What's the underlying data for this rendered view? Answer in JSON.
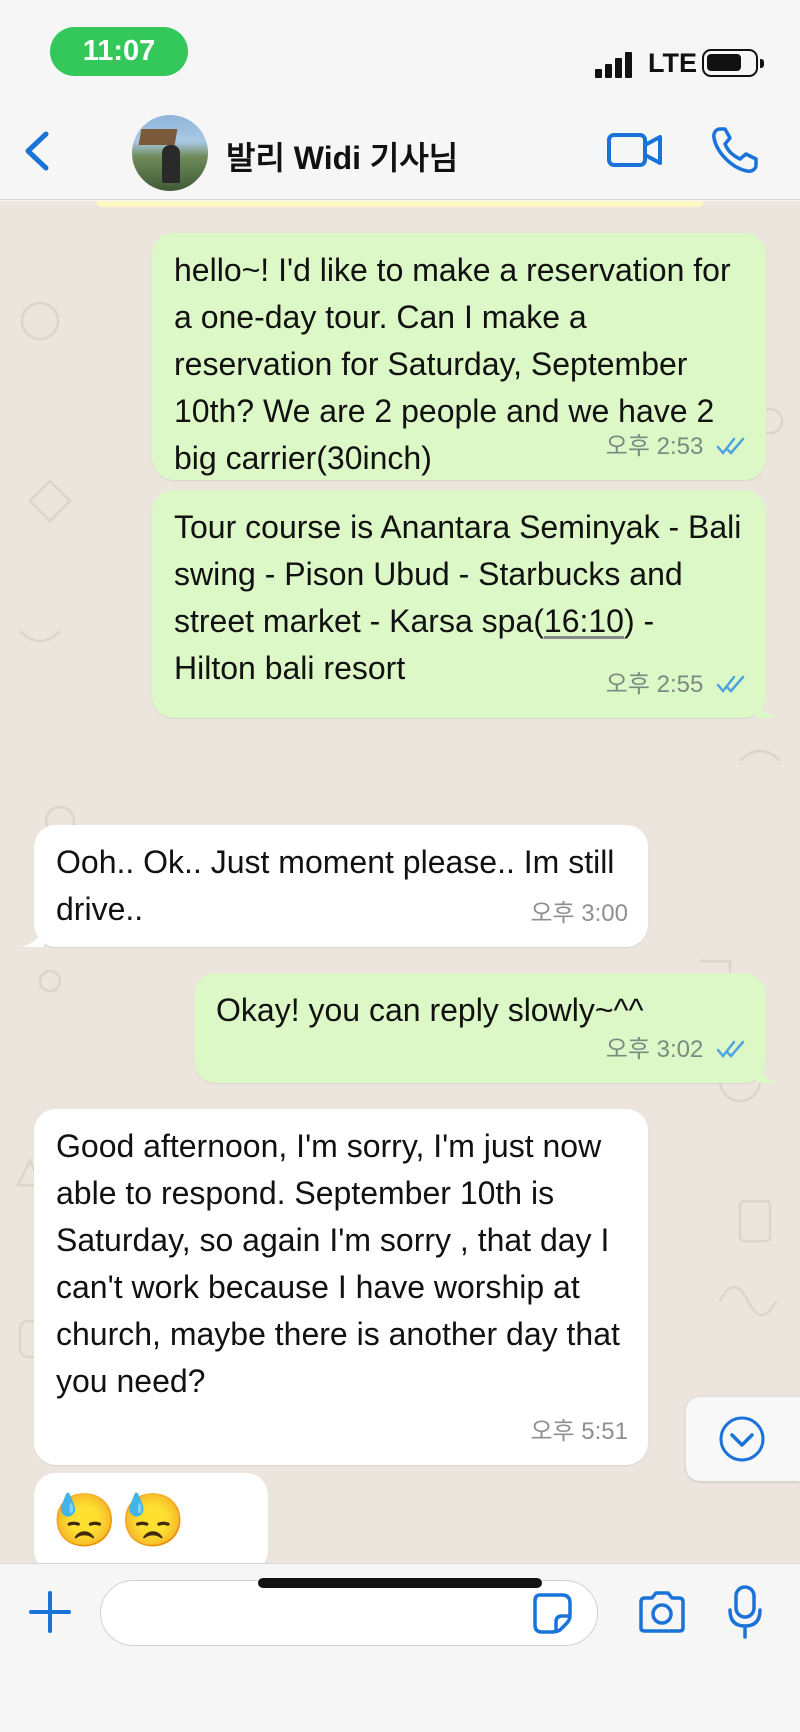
{
  "status_bar": {
    "time": "11:07",
    "network": "LTE"
  },
  "header": {
    "contact_name": "발리 Widi 기사님",
    "icons": {
      "back": "chevron-left-icon",
      "video": "video-camera-icon",
      "call": "phone-icon"
    }
  },
  "messages": [
    {
      "direction": "outgoing",
      "text": "hello~! I'd like to make a reservation for a one-day tour. Can I make a reservation for Saturday, September 10th? We are 2 people and we have 2 big carrier(30inch)",
      "time": "오후 2:53",
      "status": "read"
    },
    {
      "direction": "outgoing",
      "text_before": "Tour course is Anantara Seminyak - Bali swing - Pison Ubud - Starbucks and street market - Karsa spa(",
      "text_link": "16:10",
      "text_after": ") - Hilton bali resort",
      "time": "오후 2:55",
      "status": "read"
    },
    {
      "direction": "incoming",
      "text": "Ooh.. Ok.. Just moment please.. Im still drive..",
      "time": "오후 3:00"
    },
    {
      "direction": "outgoing",
      "text": "Okay! you can reply slowly~^^",
      "time": "오후 3:02",
      "status": "read"
    },
    {
      "direction": "incoming",
      "text": "Good afternoon, I'm sorry, I'm just now able to respond. September 10th is Saturday, so again I'm sorry , that day I can't work because I have worship at church, maybe there is another day that you need?",
      "time": "오후 5:51"
    },
    {
      "direction": "incoming",
      "emoji": "😓😓😓"
    }
  ],
  "input_bar": {
    "placeholder": "",
    "icons": {
      "attach": "plus-icon",
      "sticker": "sticker-icon",
      "camera": "camera-icon",
      "mic": "microphone-icon"
    }
  },
  "colors": {
    "accent": "#1a73d9",
    "outgoing_bubble": "#dcf8c6",
    "incoming_bubble": "#ffffff",
    "chat_background": "#ebe5de",
    "read_ticks": "#4fa3e0",
    "time_pill": "#34c759"
  }
}
